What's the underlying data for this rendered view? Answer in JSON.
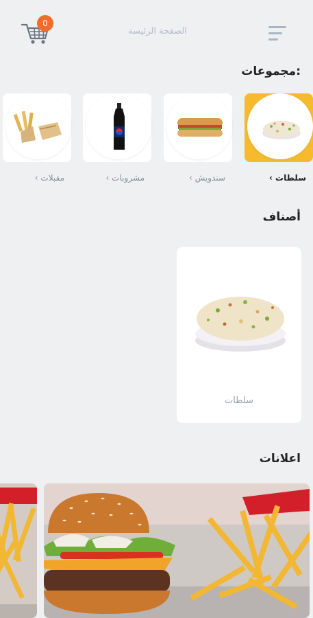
{
  "header": {
    "title": "الصفحة الرئيسة",
    "cart_count": "0"
  },
  "groups_section": {
    "title": "مجموعات:",
    "items": [
      {
        "label": "سلطات",
        "chevron": "›",
        "active": true,
        "icon": "salad"
      },
      {
        "label": "سندويش",
        "chevron": "›",
        "active": false,
        "icon": "sandwich"
      },
      {
        "label": "مشروبات",
        "chevron": "›",
        "active": false,
        "icon": "pepsi-bottle"
      },
      {
        "label": "مقبلات",
        "chevron": "›",
        "active": false,
        "icon": "appetizers"
      }
    ]
  },
  "categories_section": {
    "title": "أصناف",
    "items": [
      {
        "name": "سلطات",
        "icon": "salad"
      }
    ]
  },
  "ads_section": {
    "title": "اعلانات",
    "banners": [
      "burger-fries",
      "fries"
    ]
  },
  "colors": {
    "background": "#eef0f2",
    "active_group": "#f5ba2e",
    "badge": "#f36c2a",
    "menu_icon": "#a9b5c5"
  }
}
